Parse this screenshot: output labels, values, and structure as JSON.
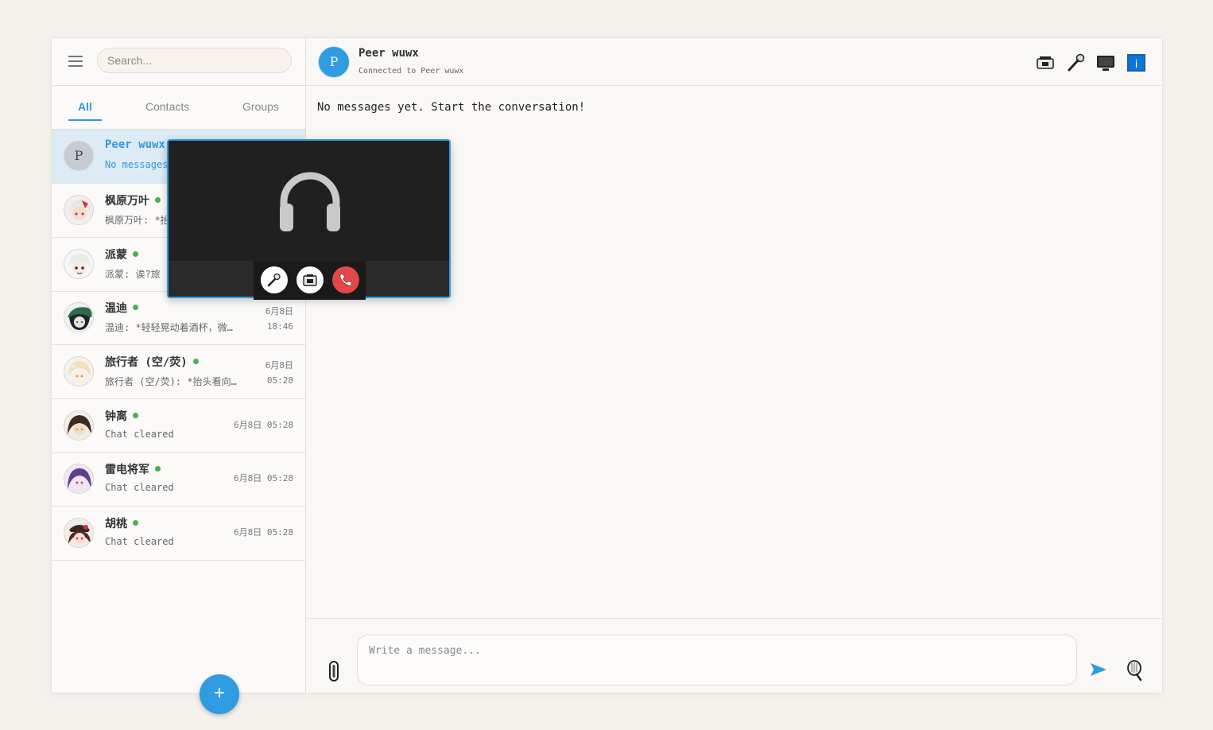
{
  "sidebar": {
    "search_placeholder": "Search...",
    "tabs": [
      {
        "label": "All",
        "active": true
      },
      {
        "label": "Contacts",
        "active": false
      },
      {
        "label": "Groups",
        "active": false
      }
    ],
    "chats": [
      {
        "name": "Peer wuwx",
        "preview": "No messages",
        "time": "",
        "online": false,
        "avatar_letter": "P",
        "active": true
      },
      {
        "name": "枫原万叶",
        "preview": "枫原万叶: *抬",
        "time": "",
        "online": true
      },
      {
        "name": "派蒙",
        "preview": "派蒙: 诶?旅",
        "time": "",
        "online": true
      },
      {
        "name": "温迪",
        "preview": "温迪: *轻轻晃动着酒杯，微…",
        "time": "6月8日\n18:46",
        "online": true
      },
      {
        "name": "旅行者 (空/荧)",
        "preview": "旅行者 (空/荧): *抬头看向…",
        "time": "6月8日\n05:28",
        "online": true
      },
      {
        "name": "钟离",
        "preview": "Chat cleared",
        "time": "6月8日 05:28",
        "online": true
      },
      {
        "name": "雷电将军",
        "preview": "Chat cleared",
        "time": "6月8日 05:28",
        "online": true
      },
      {
        "name": "胡桃",
        "preview": "Chat cleared",
        "time": "6月8日 05:28",
        "online": true
      }
    ],
    "fab_label": "+"
  },
  "header": {
    "avatar_letter": "P",
    "title": "Peer wuwx",
    "status": "Connected to Peer wuwx",
    "icons": [
      "video-camera-icon",
      "microphone-icon",
      "screen-share-icon",
      "info-icon"
    ]
  },
  "main": {
    "empty_message": "No messages yet. Start the conversation!"
  },
  "composer": {
    "placeholder": "Write a message...",
    "value": ""
  },
  "call_popup": {
    "icon": "headphones-icon",
    "controls": [
      "microphone-icon",
      "camera-icon",
      "hangup-phone-icon"
    ]
  },
  "colors": {
    "accent": "#2f9be0",
    "online": "#4caf50",
    "hangup": "#e34848",
    "active_row": "#dcebf6"
  }
}
